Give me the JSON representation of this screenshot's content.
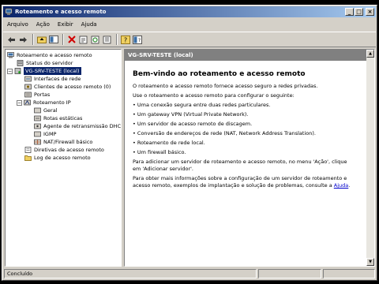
{
  "window": {
    "title": "Roteamento e acesso remoto"
  },
  "menu": [
    "Arquivo",
    "Ação",
    "Exibir",
    "Ajuda"
  ],
  "tree": {
    "root": "Roteamento e acesso remoto",
    "status": "Status do servidor",
    "server": "VG-SRV-TESTE (local)",
    "interfaces": "Interfaces de rede",
    "clients": "Clientes de acesso remoto (0)",
    "ports": "Portas",
    "ip_routing": "Roteamento IP",
    "general": "Geral",
    "static_routes": "Rotas estáticas",
    "dhcp_relay": "Agente de retransmissão DHCP",
    "igmp": "IGMP",
    "nat": "NAT/Firewall básico",
    "policies": "Diretivas de acesso remoto",
    "log": "Log de acesso remoto"
  },
  "right": {
    "header": "VG-SRV-TESTE (local)",
    "heading": "Bem-vindo ao roteamento e acesso remoto",
    "intro": "O roteamento e acesso remoto fornece acesso seguro a redes privadas.",
    "use": "Use o roteamento e acesso remoto para configurar o seguinte:",
    "bullets": [
      "• Uma conexão segura entre duas redes particulares.",
      "• Um gateway VPN (Virtual Private Network).",
      "• Um servidor de acesso remoto de discagem.",
      "• Conversão de endereços de rede (NAT, Network Address Translation).",
      "• Roteamento de rede local.",
      "• Um firewall básico."
    ],
    "add_1": "Para adicionar um servidor de roteamento e acesso remoto, no menu 'Ação', clique",
    "add_2": "em 'Adicionar servidor'.",
    "info_1": "Para obter mais informações sobre a configuração de um servidor de roteamento e",
    "info_2": "acesso remoto, exemplos de implantação e solução de problemas, consulte a ",
    "help_link": "Ajuda",
    "info_end": "."
  },
  "statusbar": {
    "text": "Concluído"
  }
}
